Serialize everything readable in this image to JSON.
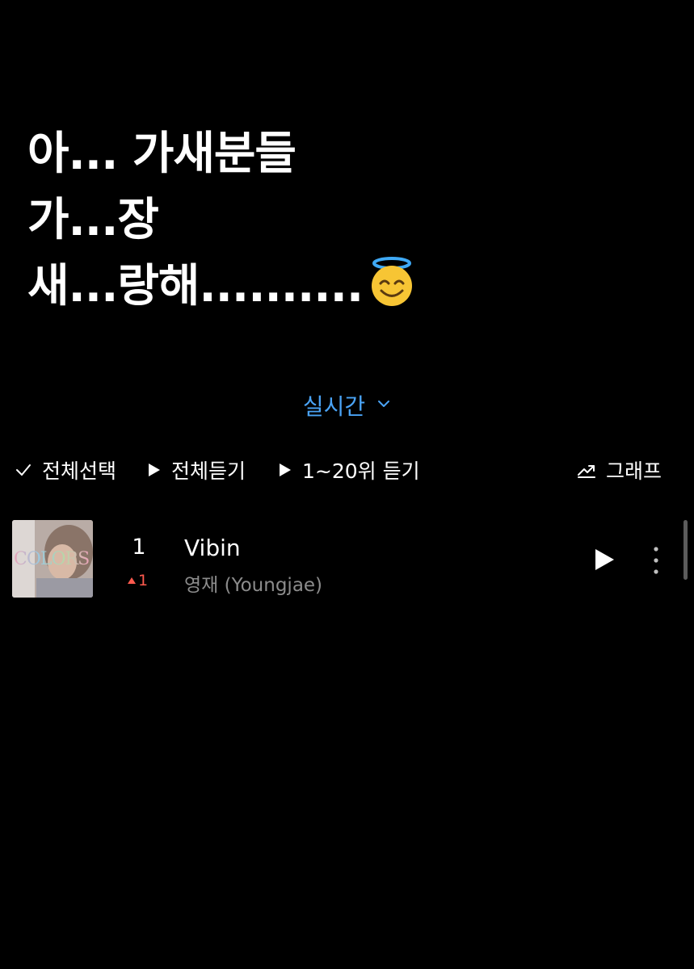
{
  "caption": {
    "line1": "아... 가새분들",
    "line2": "가...장",
    "line3": "새...랑해.........."
  },
  "emoji_icon": "smiling-face-with-halo-icon",
  "period_selector": {
    "label": "실시간",
    "icon": "chevron-down-icon"
  },
  "toolbar": {
    "select_all": "전체선택",
    "play_all": "전체듣기",
    "play_top": "1~20위 듣기",
    "graph": "그래프"
  },
  "chart_list": [
    {
      "rank": "1",
      "rank_change": "1",
      "rank_change_direction": "up",
      "title": "Vibin",
      "artist": "영재 (Youngjae)",
      "cover_text": "COLORS"
    }
  ],
  "colors": {
    "background": "#000000",
    "accent": "#4aa3f5",
    "rank_up": "#ff5a4e",
    "artist_text": "#8c8c8c"
  }
}
